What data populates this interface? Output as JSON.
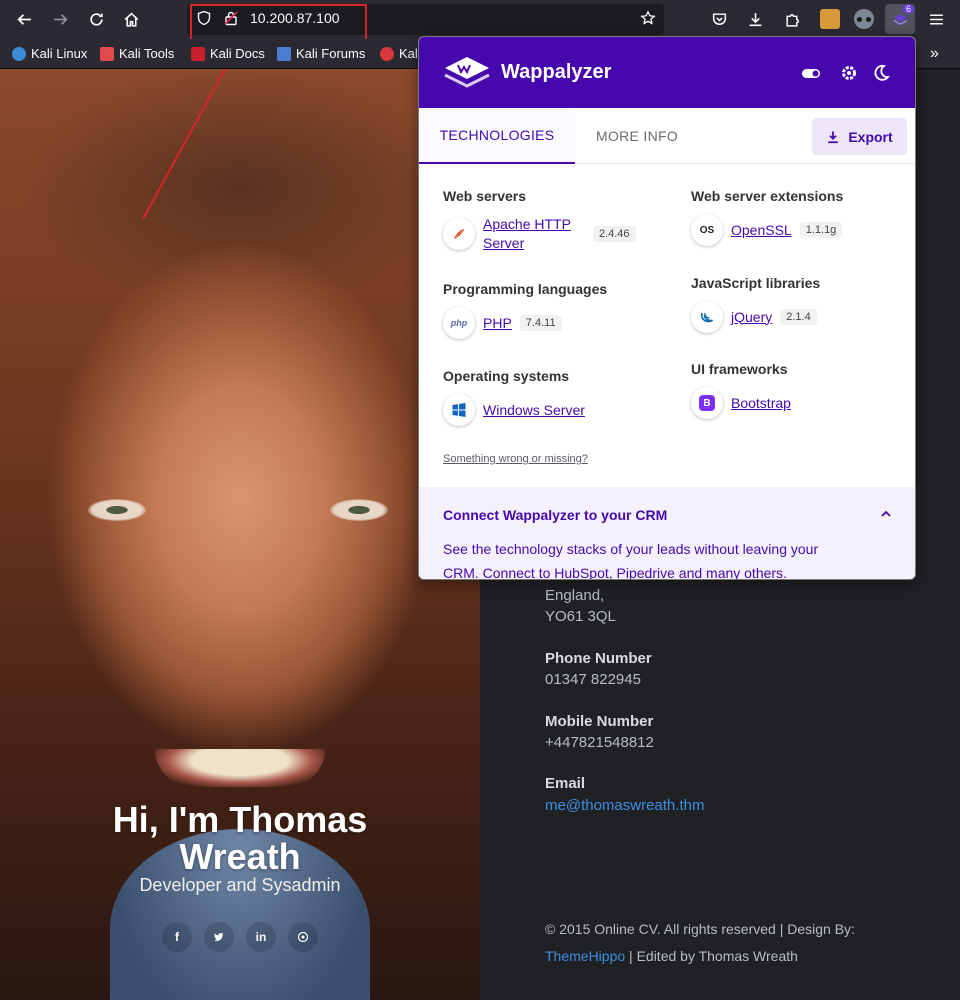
{
  "browser": {
    "url": "10.200.87.100",
    "extension_badge": "6",
    "bookmarks": [
      {
        "label": "Kali Linux"
      },
      {
        "label": "Kali Tools"
      },
      {
        "label": "Kali Docs"
      },
      {
        "label": "Kali Forums"
      },
      {
        "label": "Kal"
      }
    ]
  },
  "hero": {
    "title_line1": "Hi, I'm Thomas",
    "title_line2": "Wreath",
    "subtitle": "Developer and Sysadmin",
    "social": [
      "f",
      "t",
      "in",
      "gh"
    ]
  },
  "contact": {
    "address_line1": "England,",
    "address_line2": "YO61 3QL",
    "phone_label": "Phone Number",
    "phone": "01347 822945",
    "mobile_label": "Mobile Number",
    "mobile": "+447821548812",
    "email_label": "Email",
    "email": "me@thomaswreath.thm",
    "copyright": "© 2015 Online CV. All rights reserved | Design By:",
    "designer": "ThemeHippo",
    "edited": "| Edited by Thomas Wreath"
  },
  "wappalyzer": {
    "brand": "Wappalyzer",
    "tabs": {
      "technologies": "TECHNOLOGIES",
      "more_info": "MORE INFO"
    },
    "export_label": "Export",
    "categories": {
      "web_servers": {
        "title": "Web servers",
        "tech_line1": "Apache HTTP",
        "tech_line2": "Server",
        "version": "2.4.46"
      },
      "programming": {
        "title": "Programming languages",
        "tech": "PHP",
        "version": "7.4.11"
      },
      "os": {
        "title": "Operating systems",
        "tech": "Windows Server"
      },
      "extensions": {
        "title": "Web server extensions",
        "tech": "OpenSSL",
        "version": "1.1.1g"
      },
      "js_libs": {
        "title": "JavaScript libraries",
        "tech": "jQuery",
        "version": "2.1.4"
      },
      "ui": {
        "title": "UI frameworks",
        "tech": "Bootstrap"
      }
    },
    "missing_link": "Something wrong or missing?",
    "crm": {
      "title": "Connect Wappalyzer to your CRM",
      "text": "See the technology stacks of your leads without leaving your CRM. Connect to HubSpot, Pipedrive and many others."
    }
  },
  "colors": {
    "accent": "#4608ad",
    "highlight": "#d6252a",
    "link": "#3d8fe3"
  }
}
